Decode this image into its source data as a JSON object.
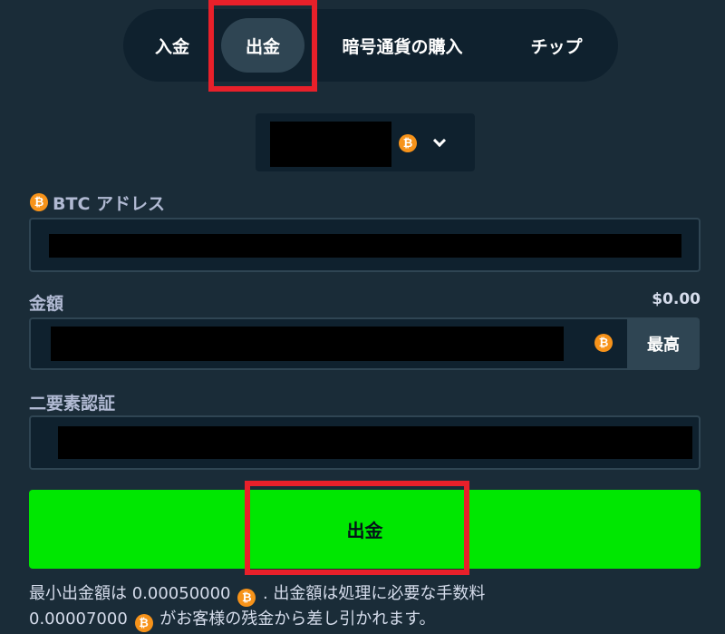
{
  "tabs": [
    {
      "label": "入金",
      "active": false
    },
    {
      "label": "出金",
      "active": true
    },
    {
      "label": "暗号通貨の購入",
      "active": false
    },
    {
      "label": "チップ",
      "active": false
    }
  ],
  "currency": {
    "icon": "bitcoin-icon",
    "symbol": "₿"
  },
  "address": {
    "label": "BTC アドレス"
  },
  "amount": {
    "label": "金額",
    "balance": "$0.00",
    "max_label": "最高"
  },
  "twofa": {
    "label": "二要素認証"
  },
  "submit": {
    "label": "出金"
  },
  "footer": {
    "line1_prefix": "最小出金額は 0.00050000",
    "line1_suffix": ". 出金額は処理に必要な手数料",
    "line2_prefix": "0.00007000",
    "line2_suffix": "がお客様の残金から差し引かれます。"
  },
  "colors": {
    "background": "#1a2c38",
    "panel": "#0f212e",
    "accent_green": "#00e701",
    "bitcoin_orange": "#f7931a",
    "highlight_red": "#e8202a"
  }
}
